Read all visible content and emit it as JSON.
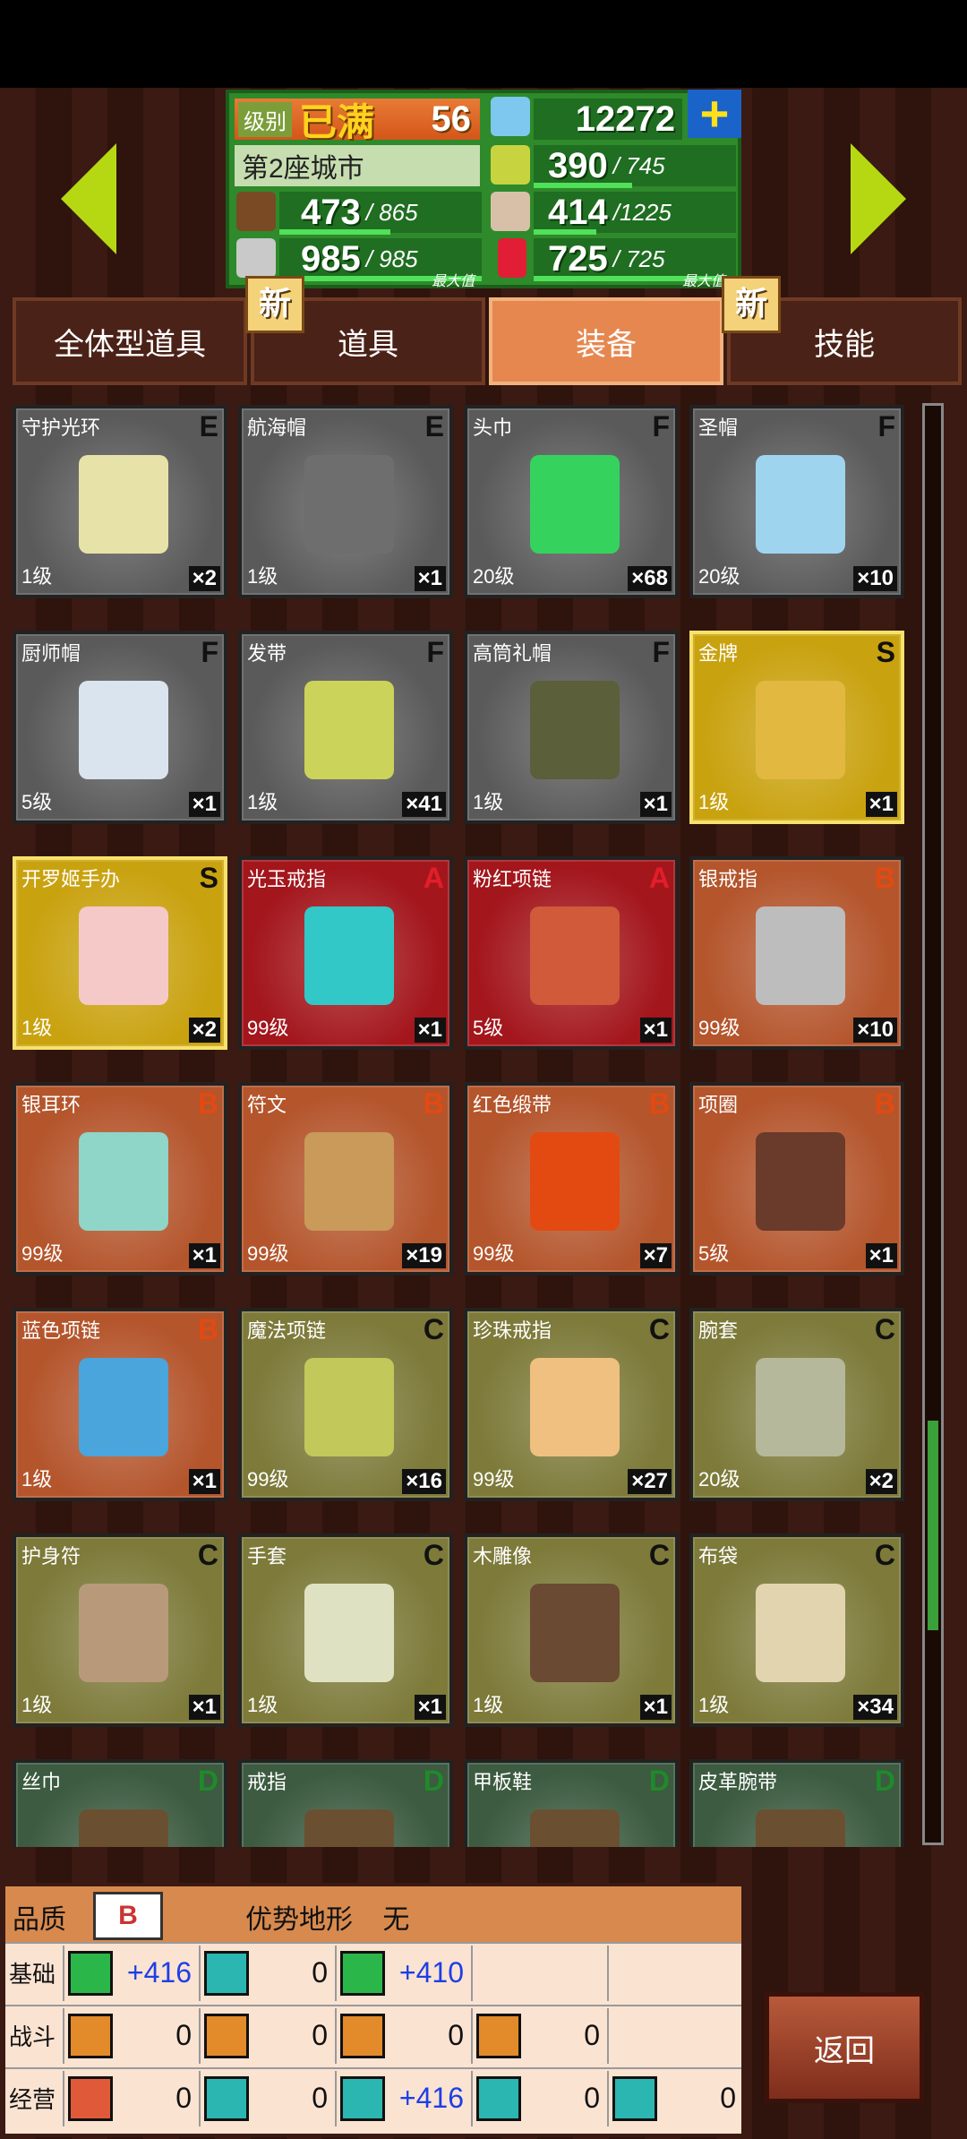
{
  "header": {
    "level_label": "级别",
    "level_max": "已满",
    "level": "56",
    "gems": "12272",
    "city": "第2座城市",
    "food": "390",
    "food_max": "745",
    "wood": "473",
    "wood_max": "865",
    "people": "414",
    "people_max": "1225",
    "ore": "985",
    "ore_max": "985",
    "ore_full": "最大值",
    "ruby": "725",
    "ruby_max": "725",
    "ruby_full": "最大值"
  },
  "tabs": [
    {
      "label": "全体型道具",
      "new": "新"
    },
    {
      "label": "道具"
    },
    {
      "label": "装备",
      "new": "新"
    },
    {
      "label": "技能"
    }
  ],
  "items": [
    {
      "name": "守护光环",
      "rank": "E",
      "level": "1级",
      "qty": "×2",
      "bg": "#5a5a5a",
      "pic": "#e7e3a8"
    },
    {
      "name": "航海帽",
      "rank": "E",
      "level": "1级",
      "qty": "×1",
      "bg": "#5a5a5a",
      "pic": "#6e6e6e"
    },
    {
      "name": "头巾",
      "rank": "F",
      "level": "20级",
      "qty": "×68",
      "bg": "#5a5a5a",
      "pic": "#35d35e"
    },
    {
      "name": "圣帽",
      "rank": "F",
      "level": "20级",
      "qty": "×10",
      "bg": "#5a5a5a",
      "pic": "#9fd4ef"
    },
    {
      "name": "厨师帽",
      "rank": "F",
      "level": "5级",
      "qty": "×1",
      "bg": "#5a5a5a",
      "pic": "#d9e4ef"
    },
    {
      "name": "发带",
      "rank": "F",
      "level": "1级",
      "qty": "×41",
      "bg": "#5a5a5a",
      "pic": "#cbd35a"
    },
    {
      "name": "高筒礼帽",
      "rank": "F",
      "level": "1级",
      "qty": "×1",
      "bg": "#5a5a5a",
      "pic": "#5b5f3a"
    },
    {
      "name": "金牌",
      "rank": "S",
      "level": "1级",
      "qty": "×1",
      "bg": "#c9a20f",
      "pic": "#e3b840"
    },
    {
      "name": "开罗姬手办",
      "rank": "S",
      "level": "1级",
      "qty": "×2",
      "bg": "#c9a20f",
      "pic": "#f6c9c9"
    },
    {
      "name": "光玉戒指",
      "rank": "A",
      "level": "99级",
      "qty": "×1",
      "bg": "#a3161c",
      "pic": "#33c8c8"
    },
    {
      "name": "粉红项链",
      "rank": "A",
      "level": "5级",
      "qty": "×1",
      "bg": "#a3161c",
      "pic": "#d05a3a"
    },
    {
      "name": "银戒指",
      "rank": "B",
      "level": "99级",
      "qty": "×10",
      "bg": "#b4552c",
      "pic": "#bdbdbd"
    },
    {
      "name": "银耳环",
      "rank": "B",
      "level": "99级",
      "qty": "×1",
      "bg": "#b4552c",
      "pic": "#8fd5c8"
    },
    {
      "name": "符文",
      "rank": "B",
      "level": "99级",
      "qty": "×19",
      "bg": "#b4552c",
      "pic": "#c99a5a"
    },
    {
      "name": "红色缎带",
      "rank": "B",
      "level": "99级",
      "qty": "×7",
      "bg": "#b4552c",
      "pic": "#e24a12"
    },
    {
      "name": "项圈",
      "rank": "B",
      "level": "5级",
      "qty": "×1",
      "bg": "#b4552c",
      "pic": "#6a3a2a"
    },
    {
      "name": "蓝色项链",
      "rank": "B",
      "level": "1级",
      "qty": "×1",
      "bg": "#b4552c",
      "pic": "#4aa5dc"
    },
    {
      "name": "魔法项链",
      "rank": "C",
      "level": "99级",
      "qty": "×16",
      "bg": "#7d7a3a",
      "pic": "#c2c85a"
    },
    {
      "name": "珍珠戒指",
      "rank": "C",
      "level": "99级",
      "qty": "×27",
      "bg": "#7d7a3a",
      "pic": "#f0c080"
    },
    {
      "name": "腕套",
      "rank": "C",
      "level": "20级",
      "qty": "×2",
      "bg": "#7d7a3a",
      "pic": "#b5b89a"
    },
    {
      "name": "护身符",
      "rank": "C",
      "level": "1级",
      "qty": "×1",
      "bg": "#7d7a3a",
      "pic": "#b89a7a"
    },
    {
      "name": "手套",
      "rank": "C",
      "level": "1级",
      "qty": "×1",
      "bg": "#7d7a3a",
      "pic": "#dfe2c2"
    },
    {
      "name": "木雕像",
      "rank": "C",
      "level": "1级",
      "qty": "×1",
      "bg": "#7d7a3a",
      "pic": "#6a4a32"
    },
    {
      "name": "布袋",
      "rank": "C",
      "level": "1级",
      "qty": "×34",
      "bg": "#7d7a3a",
      "pic": "#e3d4b0"
    },
    {
      "name": "丝巾",
      "rank": "D",
      "level": "",
      "qty": "",
      "bg": "#3c5b40",
      "pic": "#6a5030"
    },
    {
      "name": "戒指",
      "rank": "D",
      "level": "",
      "qty": "",
      "bg": "#3c5b40",
      "pic": "#6a5030"
    },
    {
      "name": "甲板鞋",
      "rank": "D",
      "level": "",
      "qty": "",
      "bg": "#3c5b40",
      "pic": "#6a5030"
    },
    {
      "name": "皮革腕带",
      "rank": "D",
      "level": "",
      "qty": "",
      "bg": "#3c5b40",
      "pic": "#6a5030"
    }
  ],
  "detail": {
    "quality_label": "品质",
    "quality": "B",
    "terrain_label": "优势地形",
    "terrain": "无",
    "rows": [
      {
        "label": "基础",
        "cells": [
          {
            "icon": "heart-icon",
            "value": "+416",
            "color": "#2bb64a"
          },
          {
            "icon": "potion-icon",
            "value": "0",
            "color": "#2bb6b1"
          },
          {
            "icon": "flex-arm-icon",
            "value": "+410",
            "color": "#2bb64a"
          },
          {
            "icon": "",
            "value": ""
          },
          {
            "icon": "",
            "value": ""
          }
        ]
      },
      {
        "label": "战斗",
        "cells": [
          {
            "icon": "sword-icon",
            "value": "0",
            "color": "#e38a2a"
          },
          {
            "icon": "shield-icon",
            "value": "0",
            "color": "#e38a2a"
          },
          {
            "icon": "arrows-icon",
            "value": "0",
            "color": "#e38a2a"
          },
          {
            "icon": "star-icon",
            "value": "0",
            "color": "#e38a2a"
          },
          {
            "icon": "",
            "value": ""
          }
        ]
      },
      {
        "label": "经营",
        "cells": [
          {
            "icon": "book-icon",
            "value": "0",
            "color": "#e05a3a"
          },
          {
            "icon": "hammer-icon",
            "value": "0",
            "color": "#2bb6b1"
          },
          {
            "icon": "shovel-icon",
            "value": "+416",
            "color": "#2bb6b1"
          },
          {
            "icon": "cart-icon",
            "value": "0",
            "color": "#2bb6b1"
          },
          {
            "icon": "bandage-icon",
            "value": "0",
            "color": "#2bb6b1"
          }
        ]
      }
    ]
  },
  "back_label": "返回",
  "colors": {
    "rankE": "#111",
    "rankS": "#111",
    "rankA": "#e21e2a",
    "rankB": "#e24a12",
    "rankC": "#111",
    "rankD": "#2e8a2a"
  }
}
